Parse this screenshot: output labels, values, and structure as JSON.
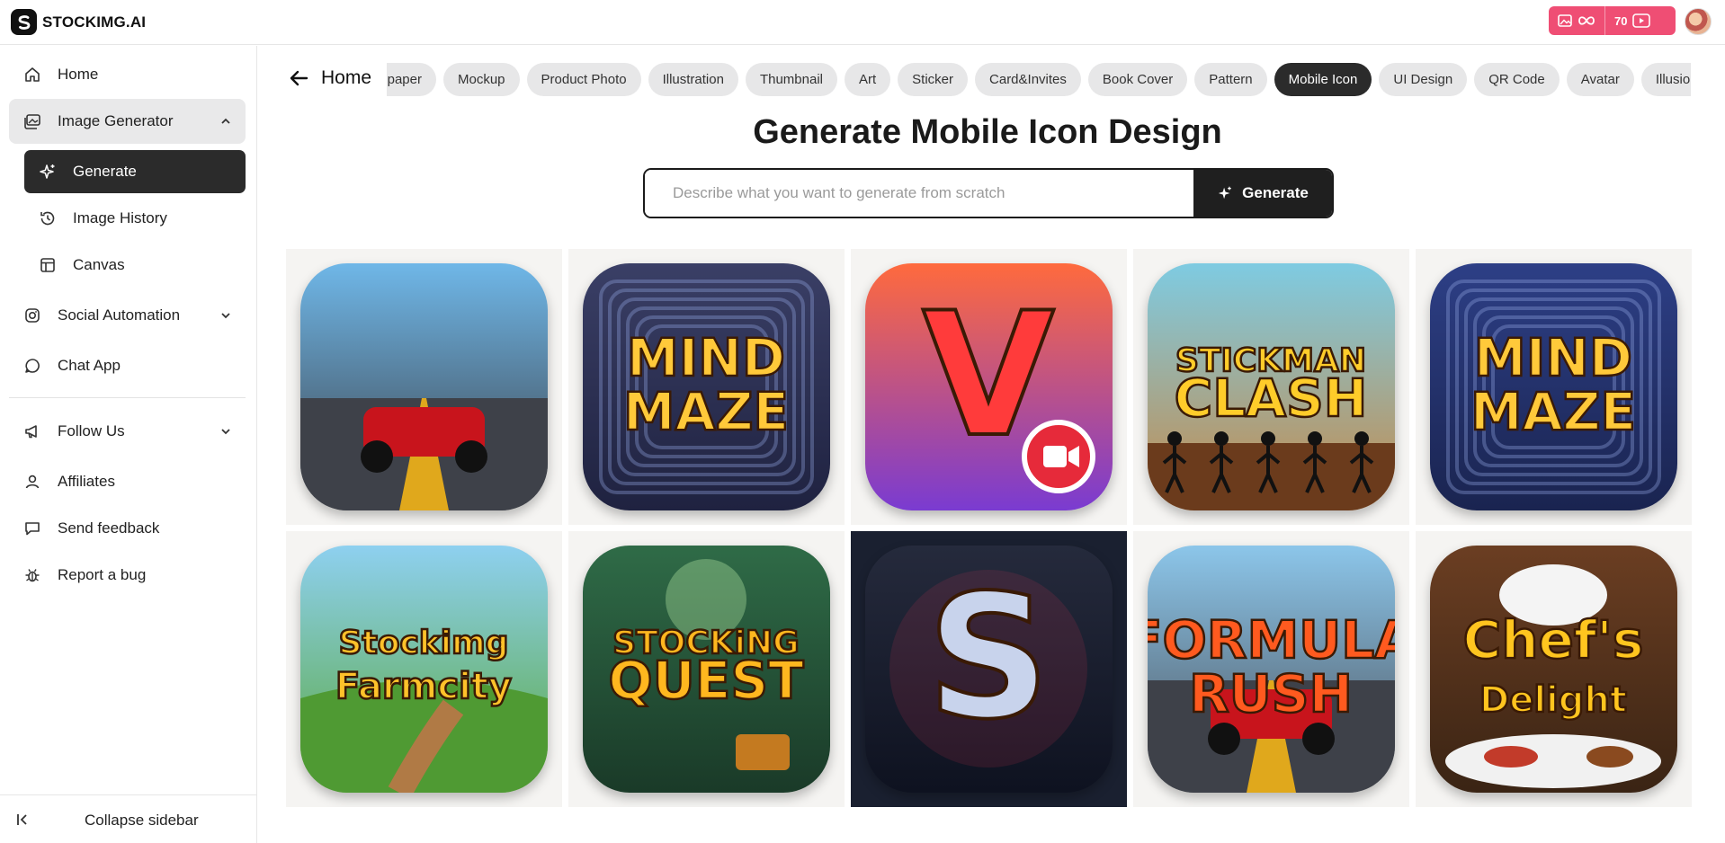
{
  "brand": {
    "name": "STOCKIMG.AI"
  },
  "header": {
    "credits_unlimited_icon": "image-infinity-icon",
    "credits_count": "70",
    "video_icon": "video-icon"
  },
  "sidebar": {
    "home": "Home",
    "image_generator": "Image Generator",
    "generate": "Generate",
    "image_history": "Image History",
    "canvas": "Canvas",
    "social_automation": "Social Automation",
    "chat_app": "Chat App",
    "follow_us": "Follow Us",
    "affiliates": "Affiliates",
    "send_feedback": "Send feedback",
    "report_bug": "Report a bug",
    "collapse": "Collapse sidebar"
  },
  "main": {
    "back_label": "Home",
    "categories": [
      "Wallpaper",
      "Mockup",
      "Product Photo",
      "Illustration",
      "Thumbnail",
      "Art",
      "Sticker",
      "Card&Invites",
      "Book Cover",
      "Pattern",
      "Mobile Icon",
      "UI Design",
      "QR Code",
      "Avatar",
      "Illusion"
    ],
    "active_category": "Mobile Icon",
    "title": "Generate Mobile Icon Design",
    "search_placeholder": "Describe what you want to generate from scratch",
    "generate_button": "Generate"
  },
  "gallery": [
    {
      "line1": "",
      "line2": "",
      "subject": "race car",
      "bg1": "#6fb7e8",
      "bg2": "#3c3f46",
      "text_color": "#ffffff"
    },
    {
      "line1": "MIND",
      "line2": "MAZE",
      "subject": "maze",
      "bg1": "#3a3f66",
      "bg2": "#1f2240",
      "text_color": "#ffc93a"
    },
    {
      "line1": "V",
      "line2": "",
      "subject": "video",
      "bg1": "#ff6a3d",
      "bg2": "#7a3bd1",
      "text_color": "#ff3b3b"
    },
    {
      "line1": "STICKMAN",
      "line2": "CLASH",
      "subject": "stickman",
      "bg1": "#7ecbe2",
      "bg2": "#c58a4a",
      "text_color": "#ffcc2a"
    },
    {
      "line1": "MIND",
      "line2": "MAZE",
      "subject": "maze",
      "bg1": "#2d3f86",
      "bg2": "#1a2450",
      "text_color": "#ffc93a"
    },
    {
      "line1": "Stockimg",
      "line2": "Farmcity",
      "subject": "farm",
      "bg1": "#8ed0f0",
      "bg2": "#5aa83d",
      "text_color": "#ffc22a"
    },
    {
      "line1": "STOCKiNG",
      "line2": "QUEST",
      "subject": "jungle",
      "bg1": "#2f6b47",
      "bg2": "#1a3a28",
      "text_color": "#ffb71f"
    },
    {
      "line1": "S",
      "line2": "",
      "subject": "letter",
      "bg1": "#252a3c",
      "bg2": "#0e1220",
      "text_color": "#c8d3ec"
    },
    {
      "line1": "FORMULA",
      "line2": "RUSH",
      "subject": "race",
      "bg1": "#8cc6ea",
      "bg2": "#4a4f58",
      "text_color": "#ff5a1f"
    },
    {
      "line1": "Chef's",
      "line2": "Delight",
      "subject": "chef",
      "bg1": "#6b3e22",
      "bg2": "#3a2414",
      "text_color": "#ffc51f"
    }
  ]
}
